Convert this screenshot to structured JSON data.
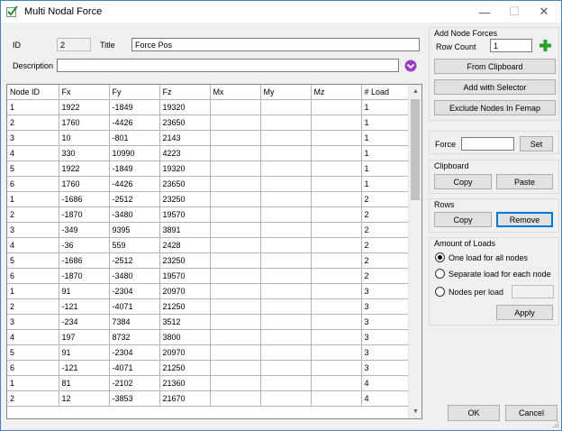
{
  "window": {
    "title": "Multi Nodal Force"
  },
  "header": {
    "id_label": "ID",
    "id_value": "2",
    "title_label": "Title",
    "title_value": "Force Pos",
    "description_label": "Description",
    "description_value": ""
  },
  "grid": {
    "columns": [
      "Node ID",
      "Fx",
      "Fy",
      "Fz",
      "Mx",
      "My",
      "Mz",
      "# Load"
    ],
    "rows": [
      [
        "1",
        "1922",
        "-1849",
        "19320",
        "",
        "",
        "",
        "1"
      ],
      [
        "2",
        "1760",
        "-4426",
        "23650",
        "",
        "",
        "",
        "1"
      ],
      [
        "3",
        "10",
        "-801",
        "2143",
        "",
        "",
        "",
        "1"
      ],
      [
        "4",
        "330",
        "10990",
        "4223",
        "",
        "",
        "",
        "1"
      ],
      [
        "5",
        "1922",
        "-1849",
        "19320",
        "",
        "",
        "",
        "1"
      ],
      [
        "6",
        "1760",
        "-4426",
        "23650",
        "",
        "",
        "",
        "1"
      ],
      [
        "1",
        "-1686",
        "-2512",
        "23250",
        "",
        "",
        "",
        "2"
      ],
      [
        "2",
        "-1870",
        "-3480",
        "19570",
        "",
        "",
        "",
        "2"
      ],
      [
        "3",
        "-349",
        "9395",
        "3891",
        "",
        "",
        "",
        "2"
      ],
      [
        "4",
        "-36",
        "559",
        "2428",
        "",
        "",
        "",
        "2"
      ],
      [
        "5",
        "-1686",
        "-2512",
        "23250",
        "",
        "",
        "",
        "2"
      ],
      [
        "6",
        "-1870",
        "-3480",
        "19570",
        "",
        "",
        "",
        "2"
      ],
      [
        "1",
        "91",
        "-2304",
        "20970",
        "",
        "",
        "",
        "3"
      ],
      [
        "2",
        "-121",
        "-4071",
        "21250",
        "",
        "",
        "",
        "3"
      ],
      [
        "3",
        "-234",
        "7384",
        "3512",
        "",
        "",
        "",
        "3"
      ],
      [
        "4",
        "197",
        "8732",
        "3800",
        "",
        "",
        "",
        "3"
      ],
      [
        "5",
        "91",
        "-2304",
        "20970",
        "",
        "",
        "",
        "3"
      ],
      [
        "6",
        "-121",
        "-4071",
        "21250",
        "",
        "",
        "",
        "3"
      ],
      [
        "1",
        "81",
        "-2102",
        "21360",
        "",
        "",
        "",
        "4"
      ],
      [
        "2",
        "12",
        "-3853",
        "21670",
        "",
        "",
        "",
        "4"
      ]
    ]
  },
  "add_node_forces": {
    "heading": "Add Node Forces",
    "row_count_label": "Row Count",
    "row_count_value": "1",
    "from_clipboard": "From Clipboard",
    "add_with_selector": "Add with Selector",
    "exclude_nodes": "Exclude Nodes In Femap"
  },
  "force": {
    "label": "Force",
    "value": "",
    "set_button": "Set"
  },
  "clipboard": {
    "heading": "Clipboard",
    "copy": "Copy",
    "paste": "Paste"
  },
  "rows_section": {
    "heading": "Rows",
    "copy": "Copy",
    "remove": "Remove"
  },
  "amount_of_loads": {
    "heading": "Amount of Loads",
    "options": [
      "One load for all nodes",
      "Separate load for each node",
      "Nodes per load"
    ],
    "selected_index": 0,
    "nodes_per_load_value": "",
    "apply": "Apply"
  },
  "footer": {
    "ok": "OK",
    "cancel": "Cancel"
  },
  "colors": {
    "accent": "#0078d7",
    "add_green": "#2aa12a",
    "dropdown_purple": "#9b3fc0"
  }
}
